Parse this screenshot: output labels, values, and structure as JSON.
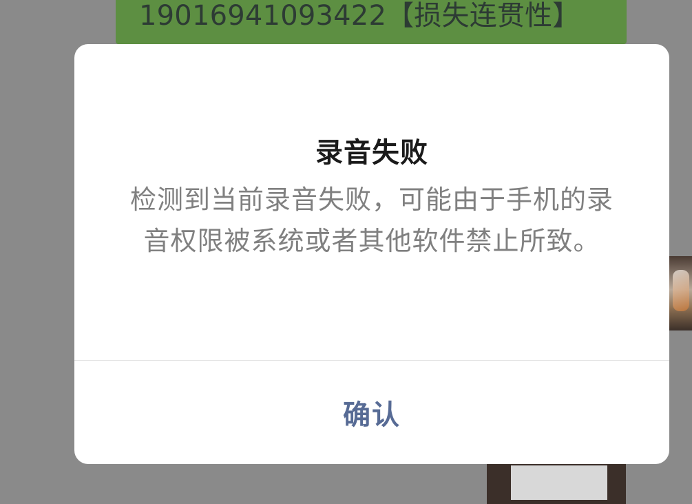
{
  "background": {
    "message_text": "19016941093422【损失连贯性】"
  },
  "dialog": {
    "title": "录音失败",
    "message": "检测到当前录音失败，可能由于手机的录音权限被系统或者其他软件禁止所致。",
    "confirm_label": "确认"
  },
  "colors": {
    "overlay_background": "#8a8a8a",
    "bubble_green": "#5d8f42",
    "dialog_background": "#ffffff",
    "title_color": "#1a1a1a",
    "message_color": "#808080",
    "confirm_color": "#576b95"
  }
}
